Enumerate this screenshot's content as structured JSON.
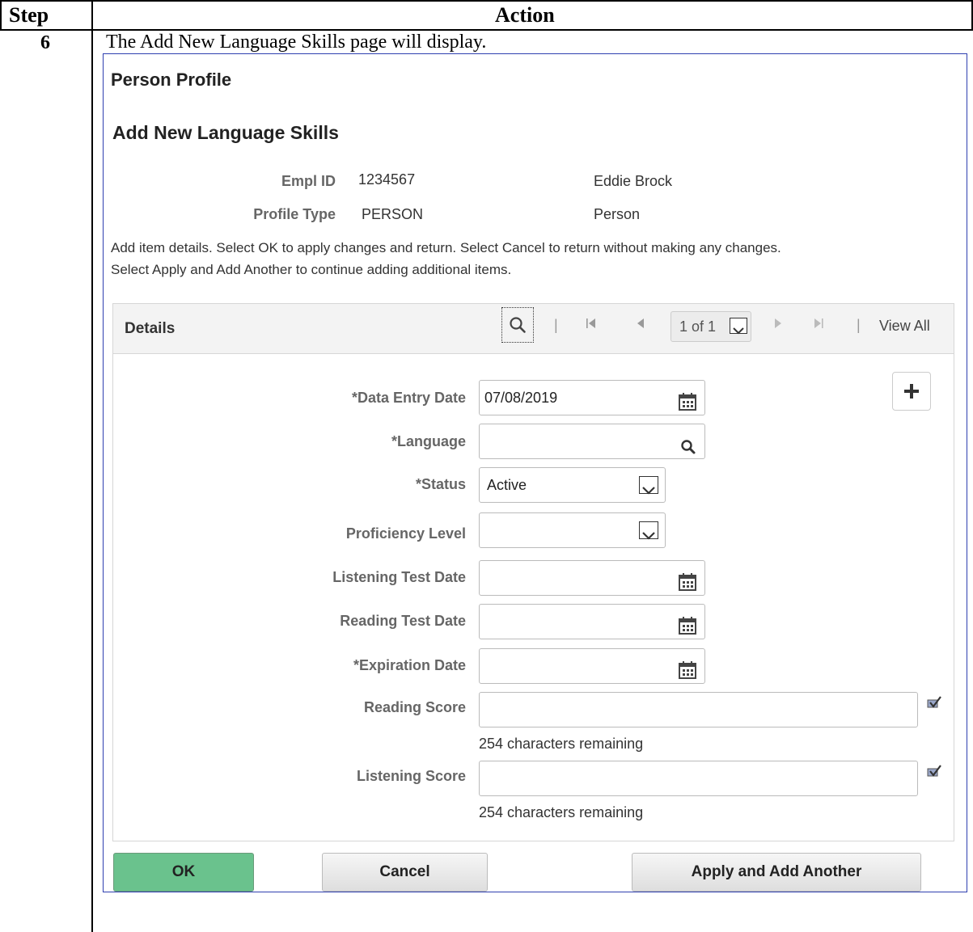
{
  "table": {
    "col_step": "Step",
    "col_action": "Action",
    "step_number": "6",
    "instruction": "The Add New Language Skills page will display."
  },
  "page": {
    "title": "Person Profile",
    "subtitle": "Add New Language Skills",
    "empl_id_label": "Empl ID",
    "empl_id_value": "1234567",
    "name": "Eddie Brock",
    "profile_type_label": "Profile Type",
    "profile_type_value": "PERSON",
    "profile_type_desc": "Person",
    "instructions_line1": "Add item details. Select OK to apply changes and return. Select Cancel to return without making any changes.",
    "instructions_line2": "Select Apply and Add Another to continue adding additional items."
  },
  "details": {
    "title": "Details",
    "page_indicator": "1 of 1",
    "view_all": "View All",
    "fields": {
      "data_entry_date": {
        "label": "*Data Entry Date",
        "value": "07/08/2019"
      },
      "language": {
        "label": "*Language",
        "value": ""
      },
      "status": {
        "label": "*Status",
        "value": "Active"
      },
      "proficiency_level": {
        "label": "Proficiency Level",
        "value": ""
      },
      "listening_test_date": {
        "label": "Listening Test Date",
        "value": ""
      },
      "reading_test_date": {
        "label": "Reading Test Date",
        "value": ""
      },
      "expiration_date": {
        "label": "*Expiration Date",
        "value": ""
      },
      "reading_score": {
        "label": "Reading Score",
        "value": "",
        "remaining": "254 characters remaining"
      },
      "listening_score": {
        "label": "Listening Score",
        "value": "",
        "remaining": "254 characters remaining"
      }
    }
  },
  "buttons": {
    "ok": "OK",
    "cancel": "Cancel",
    "apply_add": "Apply and Add Another"
  },
  "colors": {
    "ok_button": "#6ac28d",
    "screenshot_border": "#2f3fb0"
  },
  "icons": [
    "search-icon",
    "first-page-icon",
    "prev-page-icon",
    "next-page-icon",
    "last-page-icon",
    "calendar-icon",
    "plus-icon",
    "chevron-down-icon",
    "spellcheck-icon"
  ]
}
